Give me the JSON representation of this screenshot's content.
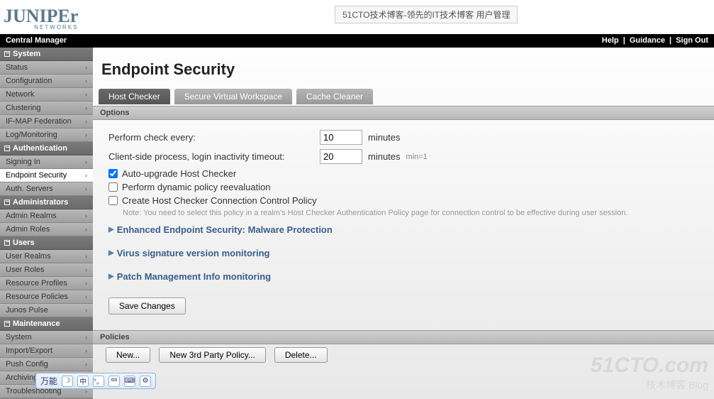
{
  "header": {
    "logo_main": "JUNIPEr",
    "logo_sub": "NETWORKS",
    "top_badge": "51CTO技术博客-领先的IT技术博客 用户管理"
  },
  "blackbar": {
    "title": "Central Manager",
    "help": "Help",
    "guidance": "Guidance",
    "signout": "Sign Out"
  },
  "sidebar": {
    "groups": [
      {
        "title": "System",
        "items": [
          "Status",
          "Configuration",
          "Network",
          "Clustering",
          "IF-MAP Federation",
          "Log/Monitoring"
        ]
      },
      {
        "title": "Authentication",
        "items": [
          "Signing In",
          "Endpoint Security",
          "Auth. Servers"
        ],
        "active_index": 1
      },
      {
        "title": "Administrators",
        "items": [
          "Admin Realms",
          "Admin Roles"
        ]
      },
      {
        "title": "Users",
        "items": [
          "User Realms",
          "User Roles",
          "Resource Profiles",
          "Resource Policies",
          "Junos Pulse"
        ]
      },
      {
        "title": "Maintenance",
        "items": [
          "System",
          "Import/Export",
          "Push Config",
          "Archiving",
          "Troubleshooting"
        ]
      }
    ]
  },
  "page": {
    "title": "Endpoint Security",
    "tabs": [
      "Host Checker",
      "Secure Virtual Workspace",
      "Cache Cleaner"
    ],
    "active_tab": 0,
    "section_options": "Options",
    "perform_label": "Perform check every:",
    "perform_value": "10",
    "minutes": "minutes",
    "timeout_label": "Client-side process, login inactivity timeout:",
    "timeout_value": "20",
    "min_hint": "min=1",
    "chk_auto": "Auto-upgrade Host Checker",
    "chk_dynamic": "Perform dynamic policy reevaluation",
    "chk_conn": "Create Host Checker Connection Control Policy",
    "note": "Note: You need to select this policy in a realm's Host Checker Authentication Policy page for connection control to be effective during user session.",
    "exp1": "Enhanced Endpoint Security: Malware Protection",
    "exp2": "Virus signature version monitoring",
    "exp3": "Patch Management Info monitoring",
    "save": "Save Changes",
    "section_policies": "Policies",
    "btn_new": "New...",
    "btn_new3p": "New 3rd Party Policy...",
    "btn_delete": "Delete..."
  },
  "floatbar": {
    "label": "万能"
  },
  "watermark": {
    "big": "51CTO.com",
    "small": "技术博客   Blog"
  }
}
